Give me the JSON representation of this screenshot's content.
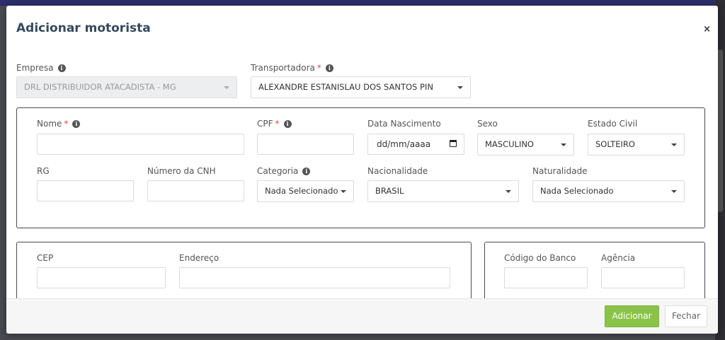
{
  "modal": {
    "title": "Adicionar motorista",
    "close_label": "×"
  },
  "empresa": {
    "label": "Empresa",
    "value": "DRL DISTRIBUIDOR ATACADISTA - MG"
  },
  "transportadora": {
    "label": "Transportadora",
    "required": "*",
    "value": "ALEXANDRE ESTANISLAU DOS SANTOS PIN"
  },
  "info_glyph": "i",
  "driver": {
    "nome": {
      "label": "Nome",
      "required": "*",
      "value": ""
    },
    "cpf": {
      "label": "CPF",
      "required": "*",
      "value": ""
    },
    "data_nascimento": {
      "label": "Data Nascimento",
      "placeholder": "dd/mm/aaaa"
    },
    "sexo": {
      "label": "Sexo",
      "value": "MASCULINO"
    },
    "estado_civil": {
      "label": "Estado Civil",
      "value": "SOLTEIRO"
    },
    "rg": {
      "label": "RG",
      "value": ""
    },
    "numero_cnh": {
      "label": "Número da CNH",
      "value": ""
    },
    "categoria": {
      "label": "Categoria",
      "value": "Nada Selecionado"
    },
    "nacionalidade": {
      "label": "Nacionalidade",
      "value": "BRASIL"
    },
    "naturalidade": {
      "label": "Naturalidade",
      "value": "Nada Selecionado"
    }
  },
  "address": {
    "cep": {
      "label": "CEP",
      "value": ""
    },
    "endereco": {
      "label": "Endereço",
      "value": ""
    }
  },
  "bank": {
    "codigo_banco": {
      "label": "Código do Banco",
      "value": ""
    },
    "agencia": {
      "label": "Agência",
      "value": ""
    }
  },
  "footer": {
    "add_label": "Adicionar",
    "close_label": "Fechar"
  },
  "colors": {
    "accent_green": "#8bc34a",
    "title": "#34495e",
    "required": "#e74c3c"
  }
}
